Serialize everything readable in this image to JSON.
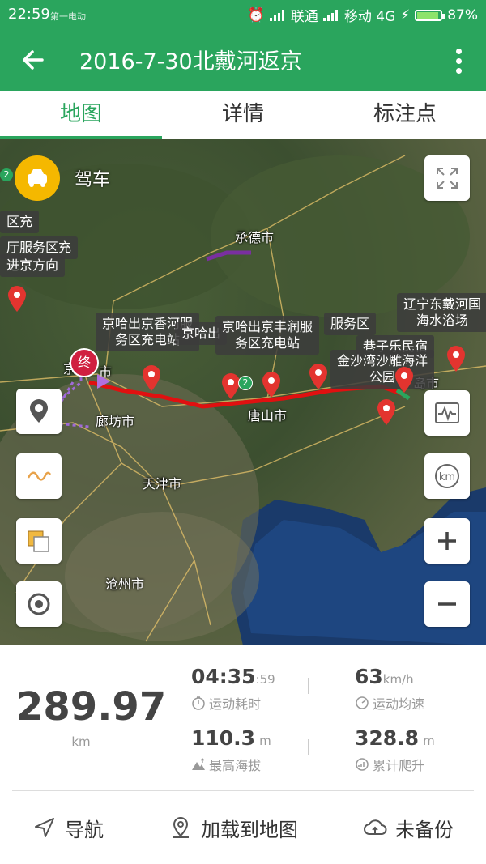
{
  "status_bar": {
    "time": "22:59",
    "app_watermark": "第一电动",
    "carrier1": "联通",
    "carrier2": "移动 4G",
    "battery": "87%"
  },
  "app_bar": {
    "title": "2016-7-30北戴河返京"
  },
  "tabs": [
    {
      "label": "地图",
      "active": true
    },
    {
      "label": "详情",
      "active": false
    },
    {
      "label": "标注点",
      "active": false
    }
  ],
  "map": {
    "mode_label": "驾车",
    "cities": {
      "chengde": "承德市",
      "langfang": "廊坊市",
      "tianjin": "天津市",
      "tangshan": "唐山市",
      "cangzhou": "沧州市",
      "beijing_partial": "京",
      "city_partial": "市",
      "dao_partial": "岛市"
    },
    "callouts": {
      "left1": "区充",
      "left2": "厅服务区充",
      "left3": "进京方向",
      "xiangshan": "京哈出京香河服\n务区充电站",
      "jinghabei": "京哈出",
      "fengrun": "京哈出京丰润服\n务区充电站",
      "fuwuqu": "服务区",
      "liaoning": "辽宁东戴河国\n海水浴场",
      "xiangzi": "巷子乐民宿",
      "jinsha": "金沙湾沙雕海洋\n公园"
    },
    "end_marker": "终",
    "badge_a": "2",
    "badge_b": "2"
  },
  "stats": {
    "distance": "289.97",
    "distance_unit": "km",
    "duration": "04:35",
    "duration_sec": ":59",
    "duration_label": "运动耗时",
    "avg_speed": "63",
    "avg_speed_unit": "km/h",
    "avg_speed_label": "运动均速",
    "max_alt": "110.3",
    "max_alt_unit": "m",
    "max_alt_label": "最高海拔",
    "climb": "328.8",
    "climb_unit": "m",
    "climb_label": "累计爬升"
  },
  "bottom": {
    "navigate": "导航",
    "load_map": "加载到地图",
    "backup": "未备份"
  },
  "colors": {
    "brand_green": "#2aa55d",
    "route_red": "#e01010",
    "pin_red": "#e3342f"
  }
}
